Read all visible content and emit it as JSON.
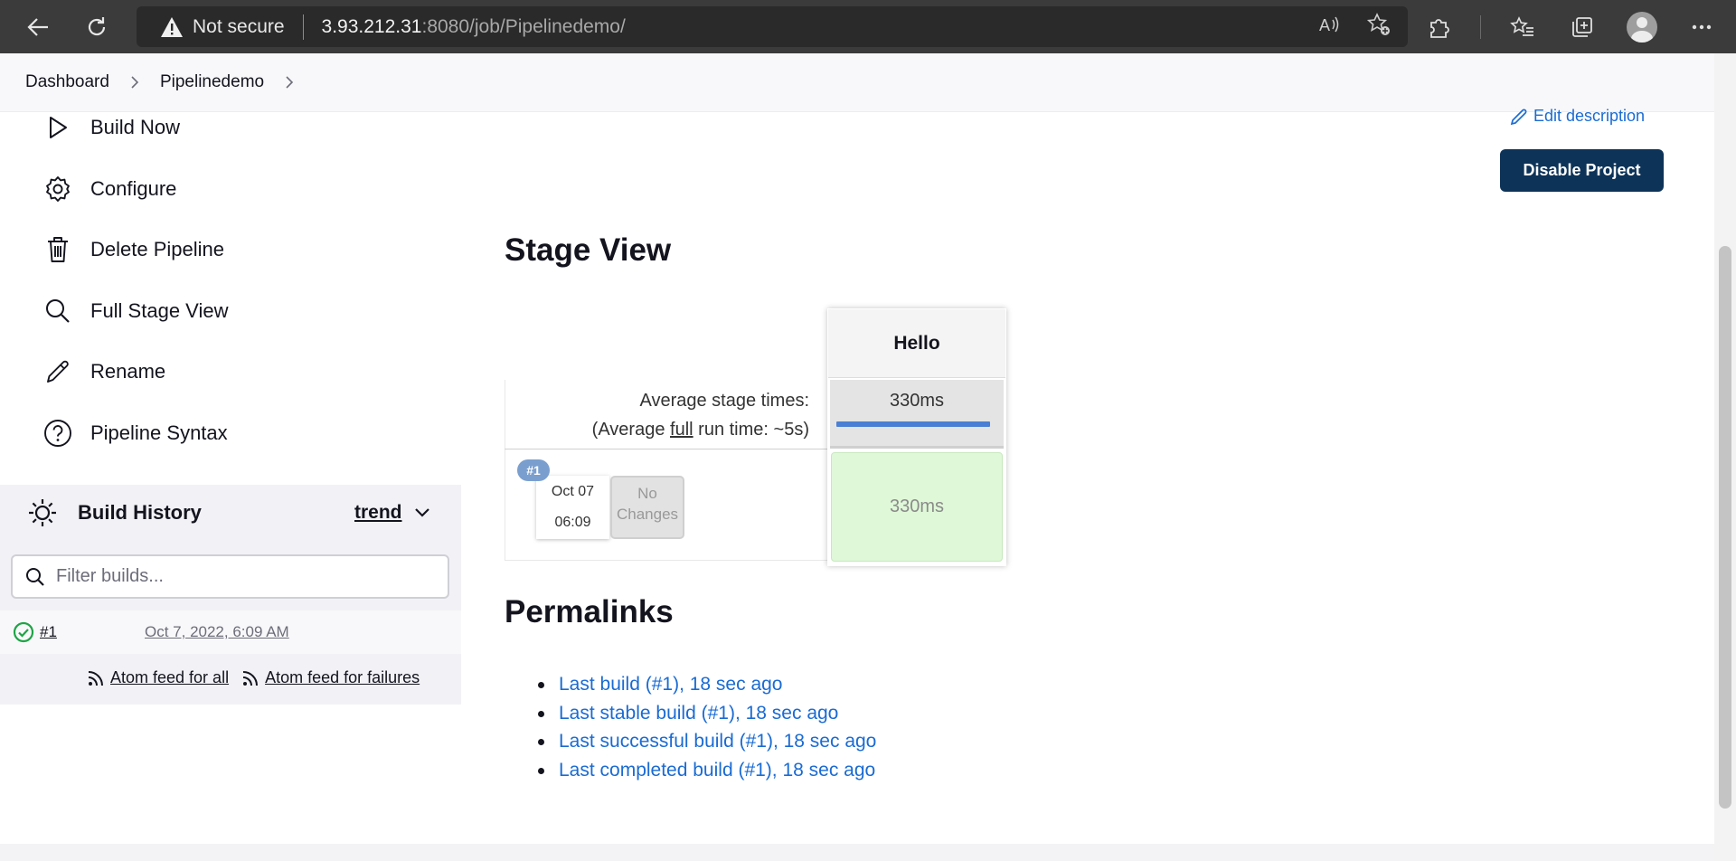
{
  "browser": {
    "security_label": "Not secure",
    "url_host": "3.93.212.31",
    "url_rest": ":8080/job/Pipelinedemo/"
  },
  "breadcrumb": {
    "items": [
      "Dashboard",
      "Pipelinedemo"
    ]
  },
  "sidebar": {
    "tasks": [
      {
        "label": "Build Now",
        "icon": "play-icon"
      },
      {
        "label": "Configure",
        "icon": "gear-icon"
      },
      {
        "label": "Delete Pipeline",
        "icon": "trash-icon"
      },
      {
        "label": "Full Stage View",
        "icon": "search-icon"
      },
      {
        "label": "Rename",
        "icon": "pencil-icon"
      },
      {
        "label": "Pipeline Syntax",
        "icon": "help-icon"
      }
    ]
  },
  "build_history": {
    "title": "Build History",
    "trend_label": "trend",
    "filter_placeholder": "Filter builds...",
    "builds": [
      {
        "number": "#1",
        "date": "Oct 7, 2022, 6:09 AM",
        "status": "success"
      }
    ],
    "feed_all": "Atom feed for all",
    "feed_failures": "Atom feed for failures"
  },
  "main": {
    "edit_description": "Edit description",
    "disable_button": "Disable Project",
    "stage_view_title": "Stage View",
    "avg_stage_times": "Average stage times:",
    "avg_full_prefix": "(Average ",
    "avg_full_word": "full",
    "avg_full_suffix": " run time: ~5s)",
    "stage": {
      "name": "Hello",
      "avg_time": "330ms",
      "avg_progress": 1.0,
      "run_time": "330ms"
    },
    "run": {
      "badge": "#1",
      "date": "Oct 07",
      "time": "06:09",
      "changes_line1": "No",
      "changes_line2": "Changes"
    },
    "permalinks_title": "Permalinks",
    "permalinks": [
      "Last build (#1), 18 sec ago",
      "Last stable build (#1), 18 sec ago",
      "Last successful build (#1), 18 sec ago",
      "Last completed build (#1), 18 sec ago"
    ]
  },
  "colors": {
    "accent_link": "#1a6bd3",
    "disable_button_bg": "#0d3358",
    "stage_success_bg": "#dff8d8",
    "success_icon": "#1ea446"
  }
}
